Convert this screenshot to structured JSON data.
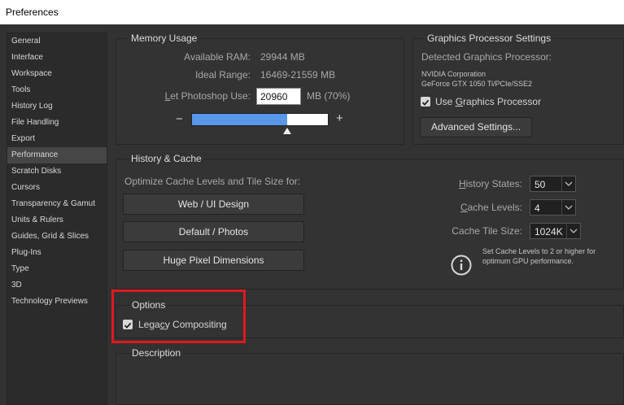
{
  "window": {
    "title": "Preferences"
  },
  "sidebar": {
    "items": [
      {
        "label": "General"
      },
      {
        "label": "Interface"
      },
      {
        "label": "Workspace"
      },
      {
        "label": "Tools"
      },
      {
        "label": "History Log"
      },
      {
        "label": "File Handling"
      },
      {
        "label": "Export"
      },
      {
        "label": "Performance"
      },
      {
        "label": "Scratch Disks"
      },
      {
        "label": "Cursors"
      },
      {
        "label": "Transparency & Gamut"
      },
      {
        "label": "Units & Rulers"
      },
      {
        "label": "Guides, Grid & Slices"
      },
      {
        "label": "Plug-Ins"
      },
      {
        "label": "Type"
      },
      {
        "label": "3D"
      },
      {
        "label": "Technology Previews"
      }
    ],
    "selected": "Performance"
  },
  "memory": {
    "title": "Memory Usage",
    "available_label": "Available RAM:",
    "available_value": "29944 MB",
    "ideal_label": "Ideal Range:",
    "ideal_value": "16469-21559 MB",
    "let_label": "Let Photoshop Use:",
    "let_value": "20960",
    "let_suffix": "MB (70%)",
    "minus": "−",
    "plus": "+",
    "slider_fraction": 0.7
  },
  "gpu": {
    "title": "Graphics Processor Settings",
    "detected_label": "Detected Graphics Processor:",
    "vendor": "NVIDIA Corporation",
    "model": "GeForce GTX 1050 Ti/PCIe/SSE2",
    "use_gpu_label": "Use Graphics Processor",
    "use_gpu_checked": true,
    "advanced_label": "Advanced Settings..."
  },
  "history": {
    "title": "History & Cache",
    "optimize_label": "Optimize Cache Levels and Tile Size for:",
    "buttons": [
      "Web / UI Design",
      "Default / Photos",
      "Huge Pixel Dimensions"
    ],
    "history_states_label": "History States:",
    "history_states_value": "50",
    "cache_levels_label": "Cache Levels:",
    "cache_levels_value": "4",
    "cache_tile_label": "Cache Tile Size:",
    "cache_tile_value": "1024K",
    "info_line1": "Set Cache Levels to 2 or higher for",
    "info_line2": "optimum GPU performance."
  },
  "options": {
    "title": "Options",
    "legacy_label": "Legacy Compositing",
    "legacy_checked": true
  },
  "description": {
    "title": "Description"
  },
  "highlight_color": "#e0191f",
  "accent_color": "#5a96ea"
}
